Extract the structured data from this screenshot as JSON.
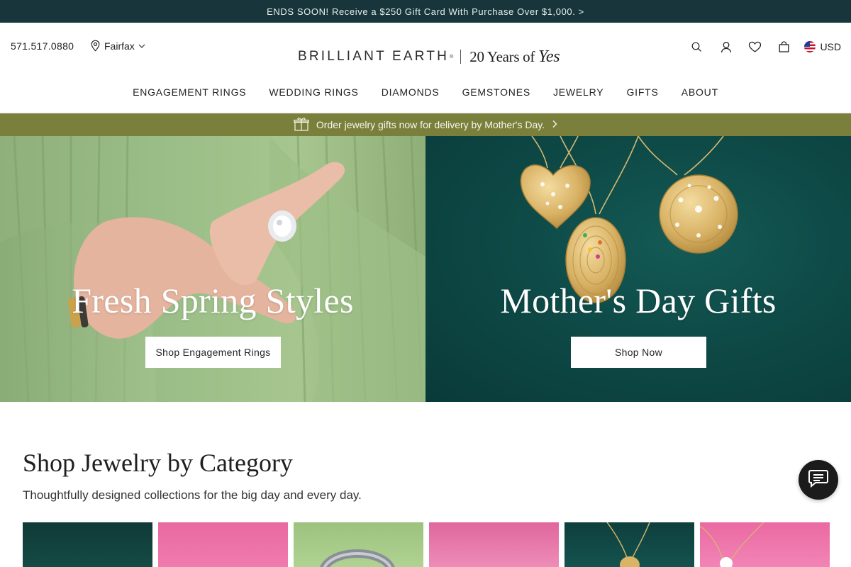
{
  "promo": {
    "text": "ENDS SOON! Receive a $250 Gift Card With Purchase Over $1,000. >"
  },
  "header": {
    "phone": "571.517.0880",
    "location": "Fairfax",
    "logo_text": "BRILLIANT EARTH",
    "logo_tagline_prefix": "20 Years of",
    "logo_tagline_script": "Yes",
    "currency": "USD",
    "icons": [
      "search-icon",
      "account-icon",
      "heart-icon",
      "bag-icon",
      "us-flag-icon"
    ]
  },
  "nav": {
    "items": [
      "ENGAGEMENT RINGS",
      "WEDDING RINGS",
      "DIAMONDS",
      "GEMSTONES",
      "JEWELRY",
      "GIFTS",
      "ABOUT"
    ]
  },
  "gift_strip": {
    "text": "Order jewelry gifts now for delivery by Mother's Day."
  },
  "heroes": [
    {
      "title": "Fresh Spring Styles",
      "button": "Shop Engagement Rings"
    },
    {
      "title": "Mother's Day Gifts",
      "button": "Shop Now"
    }
  ],
  "category": {
    "title": "Shop Jewelry by Category",
    "subtitle": "Thoughtfully designed collections for the big day and every day."
  },
  "colors": {
    "promo_bg": "#17353a",
    "gift_strip_bg": "#7a7f3b",
    "hero_left_bg": "#9bbd87",
    "hero_right_bg": "#0e4a47"
  }
}
